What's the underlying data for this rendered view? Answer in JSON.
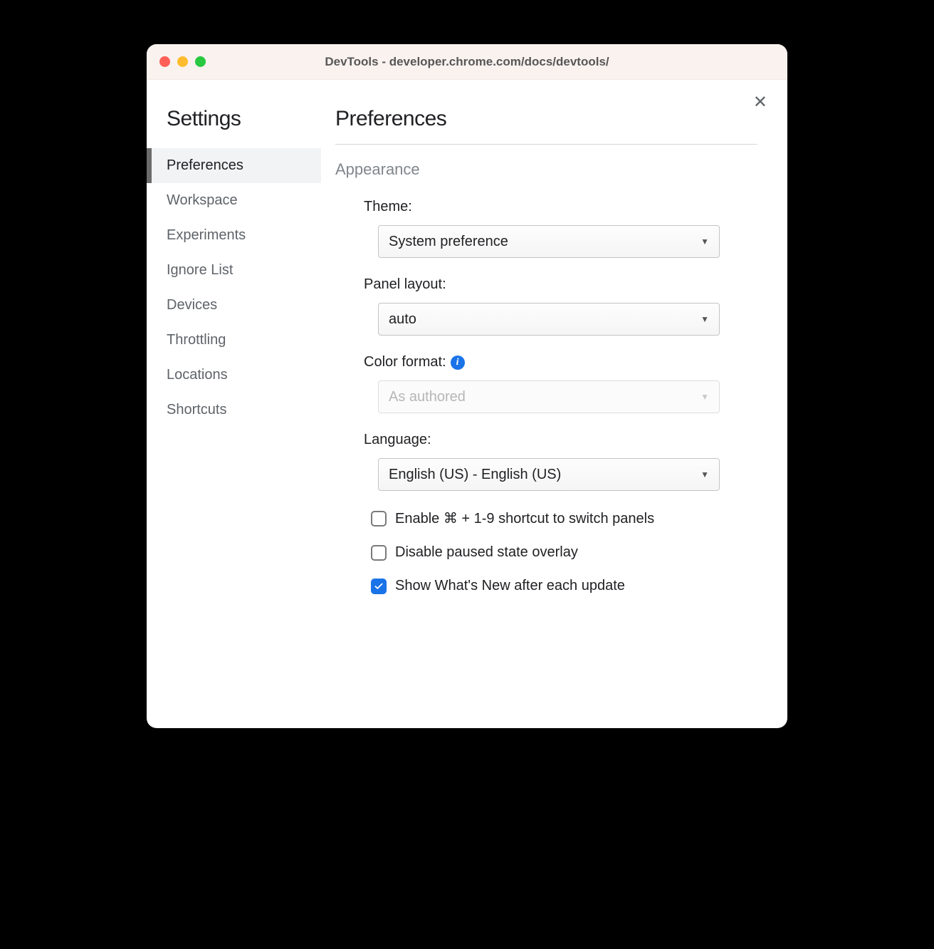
{
  "window": {
    "title": "DevTools - developer.chrome.com/docs/devtools/"
  },
  "sidebar": {
    "title": "Settings",
    "items": [
      {
        "label": "Preferences",
        "active": true
      },
      {
        "label": "Workspace",
        "active": false
      },
      {
        "label": "Experiments",
        "active": false
      },
      {
        "label": "Ignore List",
        "active": false
      },
      {
        "label": "Devices",
        "active": false
      },
      {
        "label": "Throttling",
        "active": false
      },
      {
        "label": "Locations",
        "active": false
      },
      {
        "label": "Shortcuts",
        "active": false
      }
    ]
  },
  "main": {
    "title": "Preferences",
    "section": "Appearance",
    "fields": {
      "theme": {
        "label": "Theme:",
        "value": "System preference",
        "disabled": false
      },
      "panel_layout": {
        "label": "Panel layout:",
        "value": "auto",
        "disabled": false
      },
      "color_format": {
        "label": "Color format:",
        "value": "As authored",
        "disabled": true,
        "info": true
      },
      "language": {
        "label": "Language:",
        "value": "English (US) - English (US)",
        "disabled": false
      }
    },
    "checkboxes": [
      {
        "label": "Enable ⌘ + 1-9 shortcut to switch panels",
        "checked": false
      },
      {
        "label": "Disable paused state overlay",
        "checked": false
      },
      {
        "label": "Show What's New after each update",
        "checked": true
      }
    ]
  }
}
